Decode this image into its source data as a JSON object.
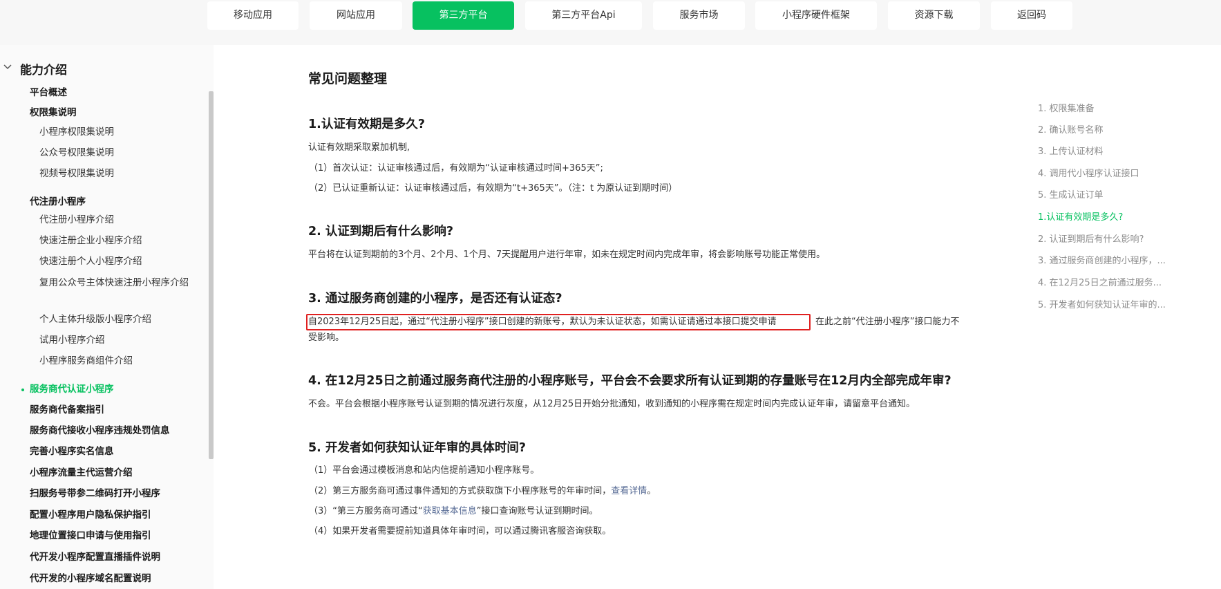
{
  "top_nav": {
    "items": [
      {
        "label": "移动应用",
        "active": false
      },
      {
        "label": "网站应用",
        "active": false
      },
      {
        "label": "第三方平台",
        "active": true
      },
      {
        "label": "第三方平台Api",
        "active": false
      },
      {
        "label": "服务市场",
        "active": false
      },
      {
        "label": "小程序硬件框架",
        "active": false
      },
      {
        "label": "资源下载",
        "active": false
      },
      {
        "label": "返回码",
        "active": false
      }
    ]
  },
  "sidebar": {
    "section_title": "能力介绍",
    "items": [
      {
        "label": "平台概述",
        "level": 1
      },
      {
        "label": "权限集说明",
        "level": 1
      },
      {
        "label": "小程序权限集说明",
        "level": 2
      },
      {
        "label": "公众号权限集说明",
        "level": 2
      },
      {
        "label": "视频号权限集说明",
        "level": 2
      },
      {
        "label": "代注册小程序",
        "level": 1
      },
      {
        "label": "代注册小程序介绍",
        "level": 2
      },
      {
        "label": "快速注册企业小程序介绍",
        "level": 2
      },
      {
        "label": "快速注册个人小程序介绍",
        "level": 2
      },
      {
        "label": "复用公众号主体快速注册小程序介绍",
        "level": 2
      },
      {
        "label": "个人主体升级版小程序介绍",
        "level": 2
      },
      {
        "label": "试用小程序介绍",
        "level": 2
      },
      {
        "label": "小程序服务商组件介绍",
        "level": 2
      },
      {
        "label": "服务商代认证小程序",
        "level": 1,
        "active": true
      },
      {
        "label": "服务商代备案指引",
        "level": 1
      },
      {
        "label": "服务商代接收小程序违规处罚信息",
        "level": 1
      },
      {
        "label": "完善小程序实名信息",
        "level": 1
      },
      {
        "label": "小程序流量主代运营介绍",
        "level": 1
      },
      {
        "label": "扫服务号带参二维码打开小程序",
        "level": 1
      },
      {
        "label": "配置小程序用户隐私保护指引",
        "level": 1
      },
      {
        "label": "地理位置接口申请与使用指引",
        "level": 1
      },
      {
        "label": "代开发小程序配置直播插件说明",
        "level": 1
      },
      {
        "label": "代开发的小程序域名配置说明",
        "level": 1
      }
    ]
  },
  "content": {
    "title": "常见问题整理",
    "q1": {
      "title": "1.认证有效期是多久?",
      "lines": [
        "认证有效期采取累加机制,",
        "（1）首次认证：认证审核通过后，有效期为“认证审核通过时间+365天”;",
        "（2）已认证重新认证：认证审核通过后，有效期为“t+365天”。（注：t 为原认证到期时间）"
      ]
    },
    "q2": {
      "title": "2. 认证到期后有什么影响?",
      "text": "平台将在认证到期前的3个月、2个月、1个月、7天提醒用户进行年审，如未在规定时间内完成年审，将会影响账号功能正常使用。"
    },
    "q3": {
      "title": "3. 通过服务商创建的小程序，是否还有认证态?",
      "highlighted": "自2023年12月25日起，通过“代注册小程序”接口创建的新账号，默认为未认证状态，如需认证请通过本接口提交申请",
      "after": "在此之前“代注册小程序”接口能力不",
      "cont": "受影响。"
    },
    "q4": {
      "title": "4. 在12月25日之前通过服务商代注册的小程序账号，平台会不会要求所有认证到期的存量账号在12月内全部完成年审?",
      "text": "不会。平台会根据小程序账号认证到期的情况进行灰度，从12月25日开始分批通知，收到通知的小程序需在规定时间内完成认证年审，请留意平台通知。"
    },
    "q5": {
      "title": "5. 开发者如何获知认证年审的具体时间?",
      "line1": "（1）平台会通过模板消息和站内信提前通知小程序账号。",
      "line2_pre": "（2）第三方服务商可通过事件通知的方式获取旗下小程序账号的年审时间，",
      "line2_link": "查看详情",
      "line2_post": "。",
      "line3_pre": "（3）“第三方服务商可通过“",
      "line3_link": "获取基本信息",
      "line3_post": "”接口查询账号认证到期时间。",
      "line4": "（4）如果开发者需要提前知道具体年审时间，可以通过腾讯客服咨询获取。"
    }
  },
  "toc": {
    "items": [
      {
        "label": "1. 权限集准备",
        "active": false
      },
      {
        "label": "2. 确认账号名称",
        "active": false
      },
      {
        "label": "3. 上传认证材料",
        "active": false
      },
      {
        "label": "4. 调用代小程序认证接口",
        "active": false
      },
      {
        "label": "5. 生成认证订单",
        "active": false
      },
      {
        "label": "1.认证有效期是多久?",
        "active": true
      },
      {
        "label": "2. 认证到期后有什么影响?",
        "active": false
      },
      {
        "label": "3. 通过服务商创建的小程序，...",
        "active": false
      },
      {
        "label": "4. 在12月25日之前通过服务...",
        "active": false
      },
      {
        "label": "5. 开发者如何获知认证年审的...",
        "active": false
      }
    ]
  },
  "colors": {
    "accent": "#07c160",
    "highlight_border": "#e02020",
    "link": "#576b95"
  }
}
